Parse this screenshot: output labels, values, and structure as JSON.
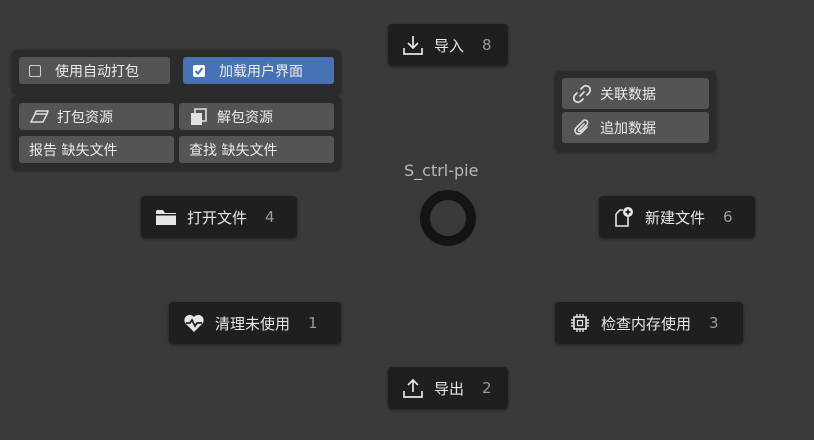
{
  "pie": {
    "title": "S_ctrl-pie",
    "items": {
      "import": {
        "label": "导入",
        "num": "8",
        "icon": "download-icon"
      },
      "open": {
        "label": "打开文件",
        "num": "4",
        "icon": "folder-icon"
      },
      "new": {
        "label": "新建文件",
        "num": "6",
        "icon": "new-file-icon"
      },
      "purge": {
        "label": "清理未使用",
        "num": "1",
        "icon": "heart-pulse-icon"
      },
      "memory": {
        "label": "检查内存使用",
        "num": "3",
        "icon": "chip-icon"
      },
      "export": {
        "label": "导出",
        "num": "2",
        "icon": "upload-icon"
      }
    }
  },
  "left_panel": {
    "auto_pack": {
      "label": "使用自动打包",
      "checked": false
    },
    "load_ui": {
      "label": "加载用户界面",
      "checked": true
    },
    "pack_resources": {
      "label": "打包资源",
      "icon": "pack-icon"
    },
    "unpack_resources": {
      "label": "解包资源",
      "icon": "unpack-icon"
    },
    "report_missing": {
      "label": "报告 缺失文件"
    },
    "find_missing": {
      "label": "查找 缺失文件"
    }
  },
  "right_panel": {
    "link_data": {
      "label": "关联数据",
      "icon": "link-icon"
    },
    "append_data": {
      "label": "追加数据",
      "icon": "paperclip-icon"
    }
  },
  "colors": {
    "background": "#3a3a3a",
    "button": "#1f1f1f",
    "accent": "#4772b3"
  }
}
